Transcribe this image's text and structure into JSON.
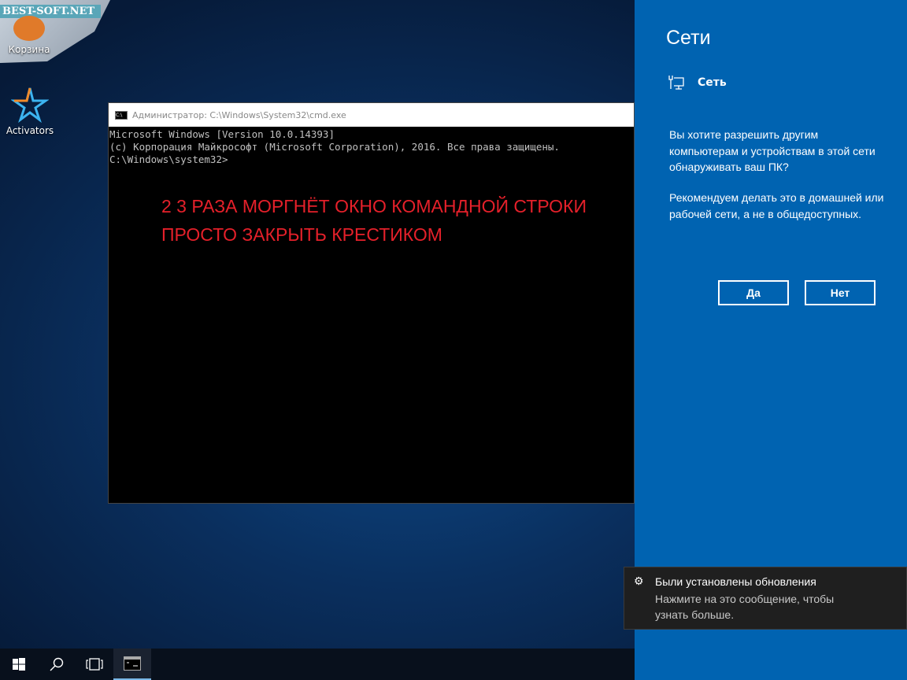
{
  "desktop": {
    "watermark": "BEST-SOFT.NET",
    "icons": [
      {
        "label": "Корзина",
        "icon": "recycle-bin-icon"
      },
      {
        "label": "Activators",
        "icon": "activators-star-icon"
      }
    ]
  },
  "cmd": {
    "title": "Администратор: C:\\Windows\\System32\\cmd.exe",
    "lines": [
      "Microsoft Windows [Version 10.0.14393]",
      "(c) Корпорация Майкрософт (Microsoft Corporation), 2016. Все права защищены.",
      "",
      "C:\\Windows\\system32>"
    ],
    "annotation": [
      "2 3 РАЗА МОРГНЁТ ОКНО КОМАНДНОЙ СТРОКИ",
      "ПРОСТО ЗАКРЫТЬ КРЕСТИКОМ"
    ],
    "annotation_color": "#e5202a"
  },
  "panel": {
    "title": "Сети",
    "network": "Сеть",
    "question": "Вы хотите разрешить другим компьютерам и устройствам в этой сети обнаруживать ваш ПК?",
    "recommend": "Рекомендуем делать это в домашней или рабочей сети, а не в общедоступных.",
    "yes": "Да",
    "no": "Нет",
    "color": "#0063b1"
  },
  "toast": {
    "title": "Были установлены обновления",
    "body": "Нажмите на это сообщение, чтобы узнать больше."
  },
  "taskbar": {
    "items": [
      "start-icon",
      "search-icon",
      "task-view-icon",
      "cmd-icon"
    ]
  }
}
